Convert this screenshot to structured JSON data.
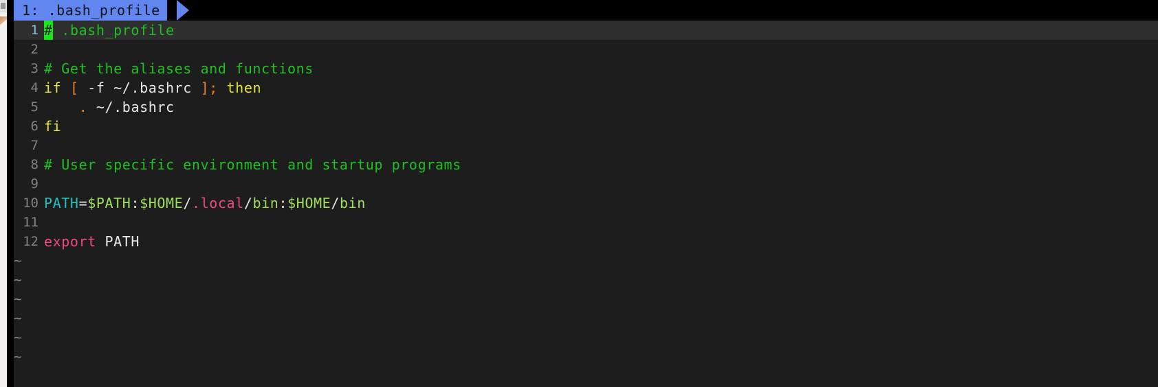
{
  "window": {
    "type": "terminal-text-editor",
    "background_color": "#1d1d1d",
    "tabline_color": "#000000"
  },
  "tabline": {
    "tabs": [
      {
        "index": "1",
        "label": "1: .bash_profile",
        "filename": ".bash_profile",
        "active": true,
        "background_color": "#6186f0",
        "text_color": "#13131a"
      }
    ]
  },
  "editor": {
    "filename": ".bash_profile",
    "cursor": {
      "line": 1,
      "column": 1,
      "char": "#",
      "color": "#19e619"
    },
    "cursorline_color": "#2e2e2e",
    "gutter_current_color": "#79c0e8",
    "gutter_color": "#7f8386",
    "total_lines": 12,
    "lines": [
      {
        "number": "1",
        "current": true,
        "tokens": [
          {
            "text": "#",
            "class": "t-comment cursor-block"
          },
          {
            "text": " .bash_profile",
            "class": "t-comment"
          }
        ]
      },
      {
        "number": "2",
        "current": false,
        "tokens": []
      },
      {
        "number": "3",
        "current": false,
        "tokens": [
          {
            "text": "# Get the aliases and functions",
            "class": "t-comment"
          }
        ]
      },
      {
        "number": "4",
        "current": false,
        "tokens": [
          {
            "text": "if ",
            "class": "t-keyword"
          },
          {
            "text": "[",
            "class": "t-bracket"
          },
          {
            "text": " -f ~/.bashrc ",
            "class": "t-plain"
          },
          {
            "text": "]",
            "class": "t-bracket"
          },
          {
            "text": ";",
            "class": "t-bracket"
          },
          {
            "text": " then",
            "class": "t-keyword"
          }
        ]
      },
      {
        "number": "5",
        "current": false,
        "tokens": [
          {
            "text": "    ",
            "class": "t-plain"
          },
          {
            "text": ".",
            "class": "t-bracket"
          },
          {
            "text": " ~/.bashrc",
            "class": "t-plain"
          }
        ]
      },
      {
        "number": "6",
        "current": false,
        "tokens": [
          {
            "text": "fi",
            "class": "t-keyword"
          }
        ]
      },
      {
        "number": "7",
        "current": false,
        "tokens": []
      },
      {
        "number": "8",
        "current": false,
        "tokens": [
          {
            "text": "# User specific environment and startup programs",
            "class": "t-comment"
          }
        ]
      },
      {
        "number": "9",
        "current": false,
        "tokens": []
      },
      {
        "number": "10",
        "current": false,
        "tokens": [
          {
            "text": "PATH",
            "class": "t-var"
          },
          {
            "text": "=",
            "class": "t-plain"
          },
          {
            "text": "$PATH",
            "class": "t-string"
          },
          {
            "text": ":",
            "class": "t-plain"
          },
          {
            "text": "$HOME",
            "class": "t-string"
          },
          {
            "text": "/",
            "class": "t-plain"
          },
          {
            "text": ".local",
            "class": "t-special"
          },
          {
            "text": "/",
            "class": "t-plain"
          },
          {
            "text": "bin",
            "class": "t-string"
          },
          {
            "text": ":",
            "class": "t-plain"
          },
          {
            "text": "$HOME",
            "class": "t-string"
          },
          {
            "text": "/",
            "class": "t-plain"
          },
          {
            "text": "bin",
            "class": "t-string"
          }
        ]
      },
      {
        "number": "11",
        "current": false,
        "tokens": []
      },
      {
        "number": "12",
        "current": false,
        "tokens": [
          {
            "text": "export",
            "class": "t-export"
          },
          {
            "text": " PATH",
            "class": "t-plain"
          }
        ]
      }
    ],
    "filler": {
      "symbol": "~",
      "color": "#8a8e91",
      "count": 6
    }
  }
}
